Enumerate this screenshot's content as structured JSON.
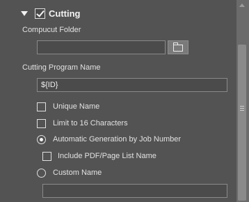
{
  "section": {
    "title": "Cutting",
    "enabled": true
  },
  "compucut_folder": {
    "label": "Compucut Folder",
    "value": ""
  },
  "cutting_program_name": {
    "label": "Cutting Program Name",
    "value": "${ID}"
  },
  "options": {
    "unique_name": "Unique Name",
    "limit_16": "Limit to 16 Characters",
    "auto_generation": "Automatic Generation by Job Number",
    "include_pdf": "Include PDF/Page List Name",
    "custom_name": "Custom Name"
  },
  "custom_name_field": {
    "value": ""
  },
  "colors": {
    "background": "#535353",
    "field_background": "#4b4b4b",
    "field_border": "#8a8a8a",
    "text": "#e2e2e2",
    "scrollbar": "#6b6b6b"
  },
  "icons": {
    "collapse": "triangle-down-icon",
    "folder": "folder-icon"
  }
}
